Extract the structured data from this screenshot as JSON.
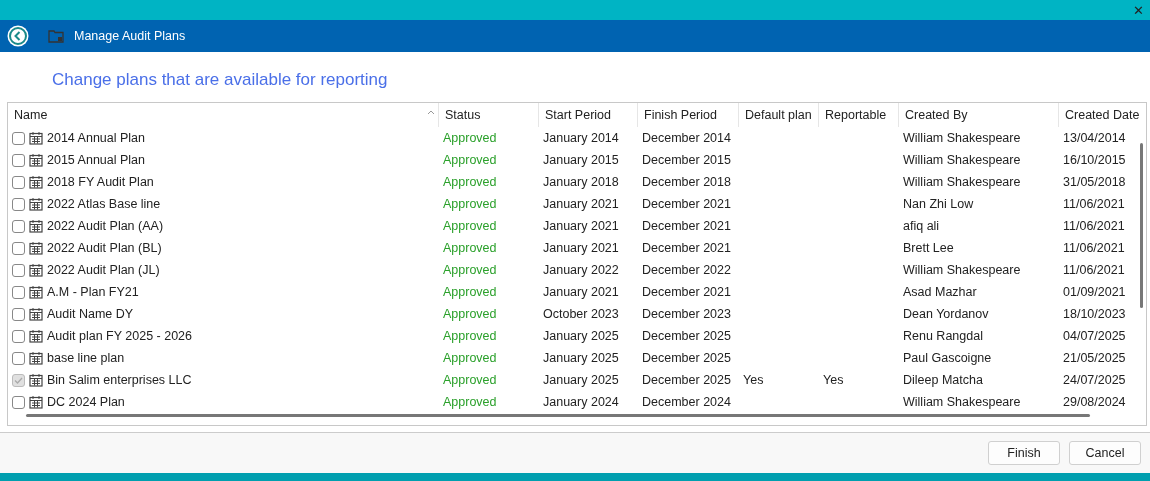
{
  "window": {
    "close": "✕"
  },
  "header": {
    "title": "Manage Audit Plans"
  },
  "heading": "Change plans that are available for reporting",
  "table": {
    "columns": [
      {
        "label": "Name",
        "sorted": true
      },
      {
        "label": "Status",
        "sorted": false
      },
      {
        "label": "Start Period",
        "sorted": false
      },
      {
        "label": "Finish Period",
        "sorted": false
      },
      {
        "label": "Default plan",
        "sorted": false
      },
      {
        "label": "Reportable",
        "sorted": false
      },
      {
        "label": "Created By",
        "sorted": false
      },
      {
        "label": "Created Date",
        "sorted": false
      }
    ],
    "rows": [
      {
        "checked": false,
        "disabled": false,
        "cells": [
          "2014 Annual Plan",
          "Approved",
          "January 2014",
          "December 2014",
          "",
          "",
          "William Shakespeare",
          "13/04/2014"
        ]
      },
      {
        "checked": false,
        "disabled": false,
        "cells": [
          "2015 Annual Plan",
          "Approved",
          "January 2015",
          "December 2015",
          "",
          "",
          "William Shakespeare",
          "16/10/2015"
        ]
      },
      {
        "checked": false,
        "disabled": false,
        "cells": [
          "2018 FY Audit Plan",
          "Approved",
          "January 2018",
          "December 2018",
          "",
          "",
          "William Shakespeare",
          "31/05/2018"
        ]
      },
      {
        "checked": false,
        "disabled": false,
        "cells": [
          "2022 Atlas Base line",
          "Approved",
          "January 2021",
          "December 2021",
          "",
          "",
          "Nan Zhi Low",
          "11/06/2021"
        ]
      },
      {
        "checked": false,
        "disabled": false,
        "cells": [
          "2022 Audit Plan (AA)",
          "Approved",
          "January 2021",
          "December 2021",
          "",
          "",
          "afiq ali",
          "11/06/2021"
        ]
      },
      {
        "checked": false,
        "disabled": false,
        "cells": [
          "2022 Audit Plan (BL)",
          "Approved",
          "January 2021",
          "December 2021",
          "",
          "",
          "Brett Lee",
          "11/06/2021"
        ]
      },
      {
        "checked": false,
        "disabled": false,
        "cells": [
          "2022 Audit Plan (JL)",
          "Approved",
          "January 2022",
          "December 2022",
          "",
          "",
          "William Shakespeare",
          "11/06/2021"
        ]
      },
      {
        "checked": false,
        "disabled": false,
        "cells": [
          "A.M - Plan FY21",
          "Approved",
          "January 2021",
          "December 2021",
          "",
          "",
          "Asad Mazhar",
          "01/09/2021"
        ]
      },
      {
        "checked": false,
        "disabled": false,
        "cells": [
          "Audit Name DY",
          "Approved",
          "October 2023",
          "December 2023",
          "",
          "",
          "Dean Yordanov",
          "18/10/2023"
        ]
      },
      {
        "checked": false,
        "disabled": false,
        "cells": [
          "Audit plan FY 2025 - 2026",
          "Approved",
          "January 2025",
          "December 2025",
          "",
          "",
          "Renu Rangdal",
          "04/07/2025"
        ]
      },
      {
        "checked": false,
        "disabled": false,
        "cells": [
          "base line plan",
          "Approved",
          "January 2025",
          "December 2025",
          "",
          "",
          "Paul Gascoigne",
          "21/05/2025"
        ]
      },
      {
        "checked": true,
        "disabled": true,
        "cells": [
          "Bin Salim enterprises LLC",
          "Approved",
          "January 2025",
          "December 2025",
          "Yes",
          "Yes",
          "Dileep Matcha",
          "24/07/2025"
        ]
      },
      {
        "checked": false,
        "disabled": false,
        "cells": [
          "DC 2024 Plan",
          "Approved",
          "January 2024",
          "December 2024",
          "",
          "",
          "William Shakespeare",
          "29/08/2024"
        ]
      }
    ]
  },
  "buttons": [
    "Finish",
    "Cancel"
  ]
}
